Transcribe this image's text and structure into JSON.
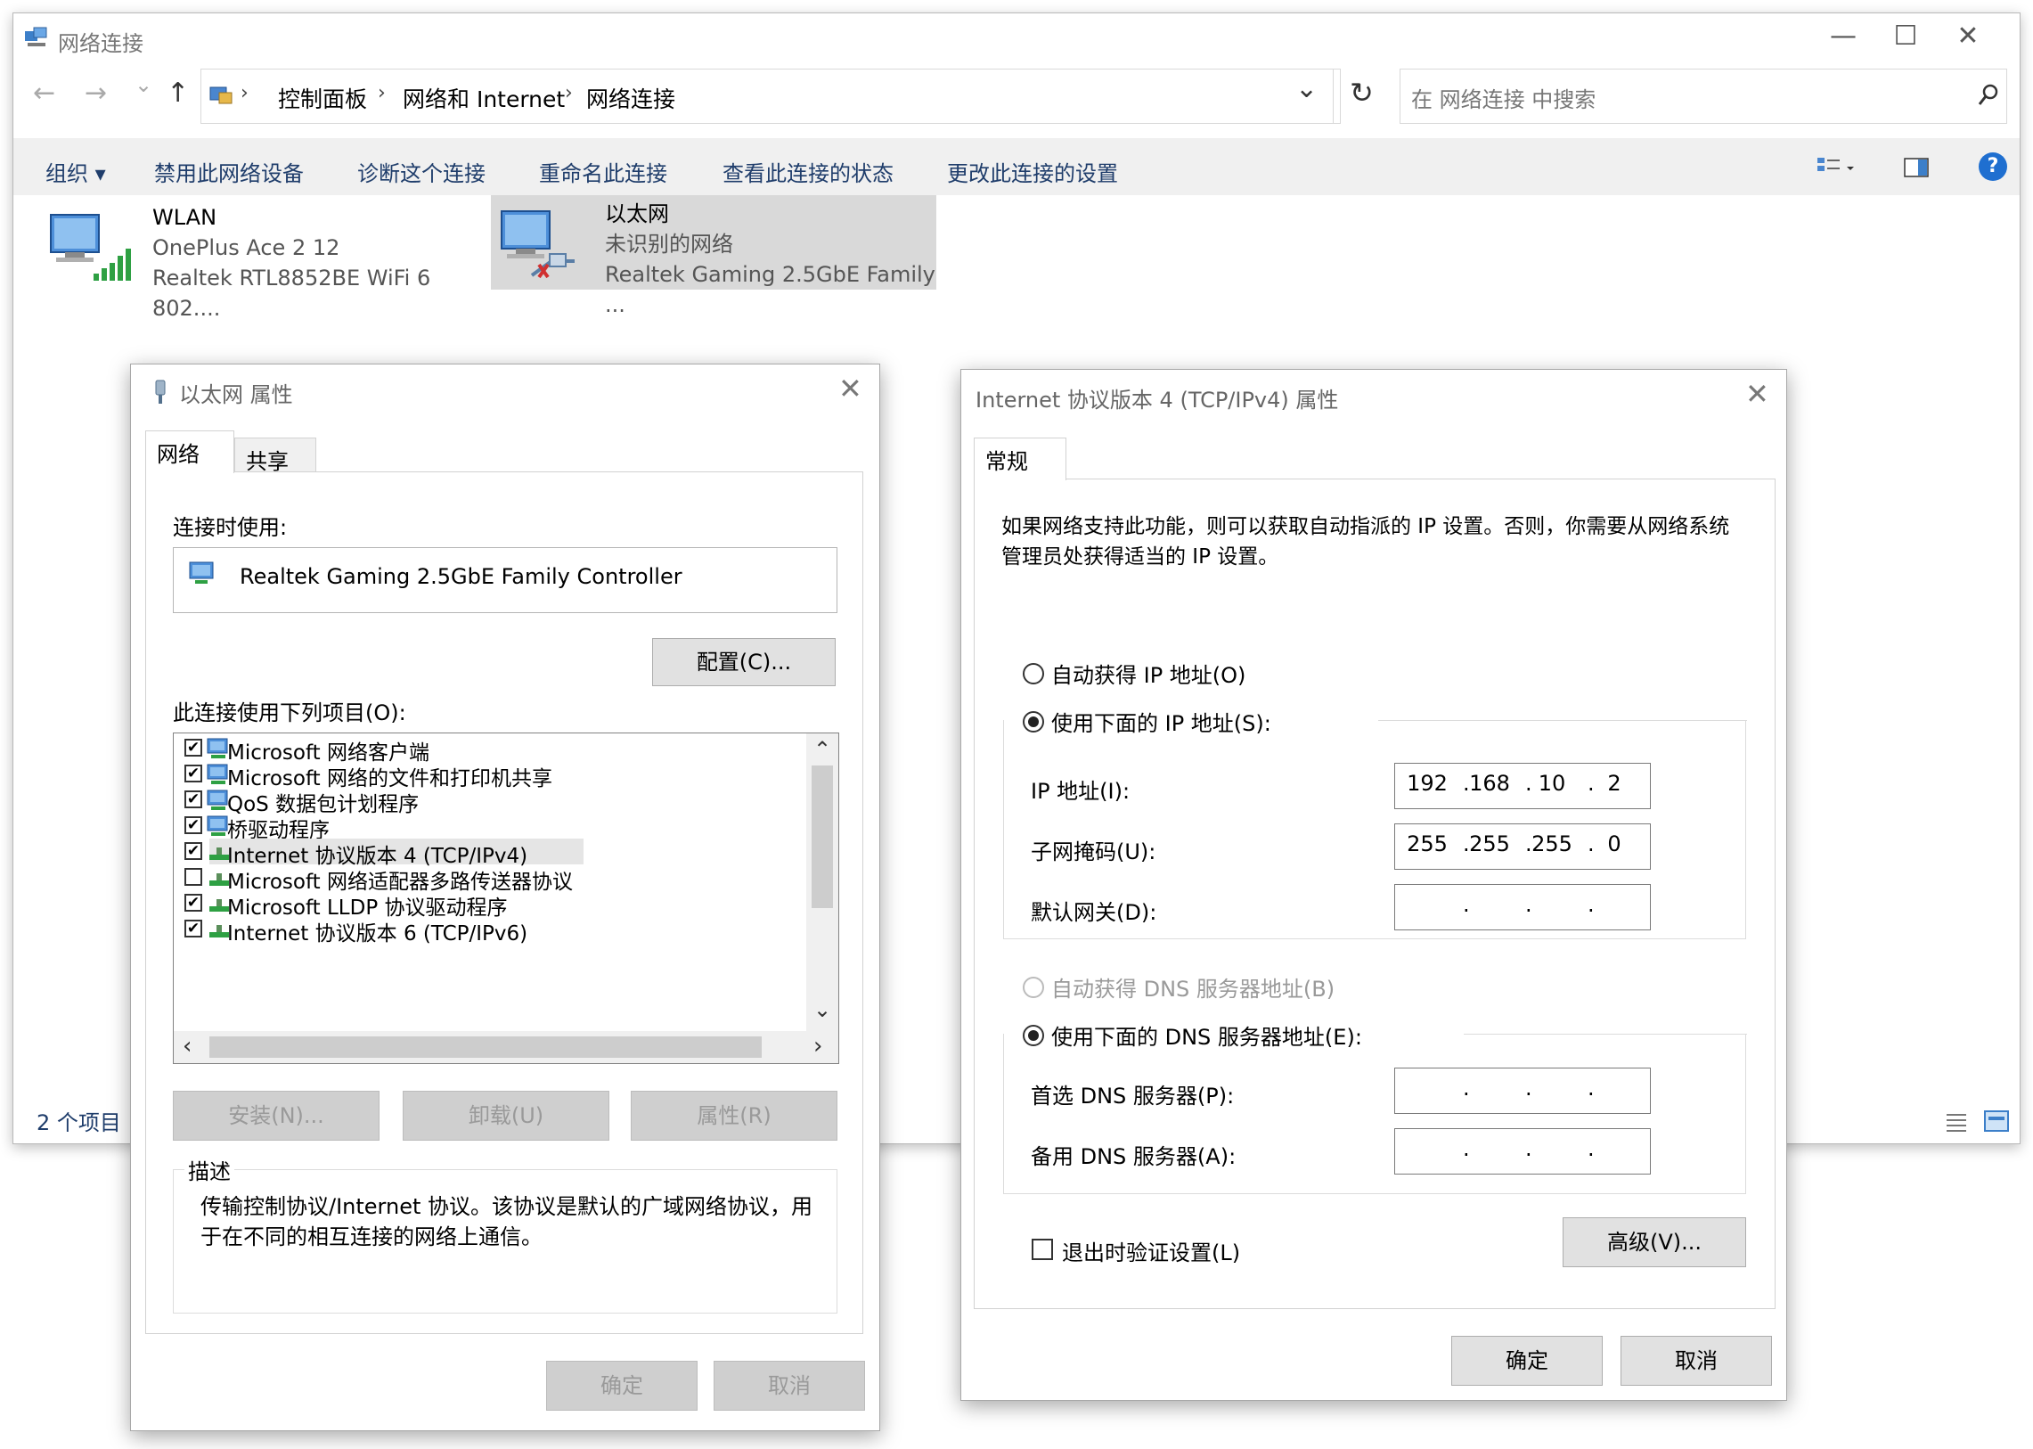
{
  "window": {
    "title": "网络连接",
    "minimize_glyph": "—",
    "maximize_glyph": "☐",
    "close_glyph": "✕"
  },
  "nav": {
    "back_glyph": "←",
    "forward_glyph": "→",
    "recent_glyph": "⌄",
    "up_glyph": "↑"
  },
  "address": {
    "crumbs": [
      "控制面板",
      "网络和 Internet",
      "网络连接"
    ],
    "separator": "›",
    "dropdown_glyph": "⌄",
    "refresh_glyph": "↻"
  },
  "search": {
    "placeholder": "在 网络连接 中搜索",
    "icon": "search-icon"
  },
  "commands": {
    "organize": "组织 ▾",
    "disable": "禁用此网络设备",
    "diagnose": "诊断这个连接",
    "rename": "重命名此连接",
    "status": "查看此连接的状态",
    "settings": "更改此连接的设置",
    "help_glyph": "?"
  },
  "connections": [
    {
      "name": "WLAN",
      "network": "OnePlus Ace 2 12",
      "adapter": "Realtek RTL8852BE WiFi 6 802...."
    },
    {
      "name": "以太网",
      "network": "未识别的网络",
      "adapter": "Realtek Gaming 2.5GbE Family ..."
    }
  ],
  "statusbar": {
    "count": "2 个项目"
  },
  "eth_dialog": {
    "title": "以太网 属性",
    "close_glyph": "✕",
    "tabs": [
      "网络",
      "共享"
    ],
    "connect_using_label": "连接时使用:",
    "adapter": "Realtek Gaming 2.5GbE Family Controller",
    "configure": "配置(C)...",
    "items_label": "此连接使用下列项目(O):",
    "items": [
      {
        "label": "Microsoft 网络客户端",
        "checked": "✔"
      },
      {
        "label": "Microsoft 网络的文件和打印机共享",
        "checked": "✔"
      },
      {
        "label": "QoS 数据包计划程序",
        "checked": "✔"
      },
      {
        "label": "桥驱动程序",
        "checked": "✔"
      },
      {
        "label": "Internet 协议版本 4 (TCP/IPv4)",
        "checked": "✔"
      },
      {
        "label": "Microsoft 网络适配器多路传送器协议",
        "checked": ""
      },
      {
        "label": "Microsoft LLDP 协议驱动程序",
        "checked": "✔"
      },
      {
        "label": "Internet 协议版本 6 (TCP/IPv6)",
        "checked": "✔"
      }
    ],
    "scroll_up": "⌃",
    "scroll_down": "⌄",
    "scroll_left": "‹",
    "scroll_right": "›",
    "install": "安装(N)...",
    "uninstall": "卸载(U)",
    "properties": "属性(R)",
    "description_label": "描述",
    "description": "传输控制协议/Internet 协议。该协议是默认的广域网络协议，用于在不同的相互连接的网络上通信。",
    "ok": "确定",
    "cancel": "取消"
  },
  "ipv4_dialog": {
    "title": "Internet 协议版本 4 (TCP/IPv4) 属性",
    "close_glyph": "✕",
    "tab": "常规",
    "intro": "如果网络支持此功能，则可以获取自动指派的 IP 设置。否则，你需要从网络系统管理员处获得适当的 IP 设置。",
    "auto_ip": "自动获得 IP 地址(O)",
    "manual_ip": "使用下面的 IP 地址(S):",
    "ip_label": "IP 地址(I):",
    "ip": [
      "192",
      "168",
      "10",
      "2"
    ],
    "mask_label": "子网掩码(U):",
    "mask": [
      "255",
      "255",
      "255",
      "0"
    ],
    "gateway_label": "默认网关(D):",
    "auto_dns": "自动获得 DNS 服务器地址(B)",
    "manual_dns": "使用下面的 DNS 服务器地址(E):",
    "dns1_label": "首选 DNS 服务器(P):",
    "dns2_label": "备用 DNS 服务器(A):",
    "dot": ".",
    "validate": "退出时验证设置(L)",
    "advanced": "高级(V)...",
    "ok": "确定",
    "cancel": "取消"
  }
}
